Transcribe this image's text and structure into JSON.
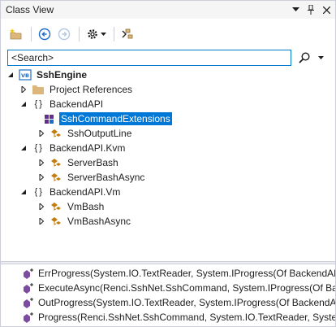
{
  "window": {
    "title": "Class View",
    "buttons": {
      "dropdown": "▾",
      "pin": "📌",
      "close": "✕"
    }
  },
  "toolbar": {
    "items": [
      "new-folder",
      "back",
      "forward",
      "settings",
      "sync"
    ]
  },
  "search": {
    "value": "<Search>"
  },
  "tree": {
    "root": {
      "label": "SshEngine",
      "badge": "VB"
    },
    "items": [
      {
        "label": "Project References"
      },
      {
        "label": "BackendAPI",
        "ns": "{ }"
      },
      {
        "label": "SshCommandExtensions",
        "selected": true
      },
      {
        "label": "SshOutputLine"
      },
      {
        "label": "BackendAPI.Kvm",
        "ns": "{ }"
      },
      {
        "label": "ServerBash"
      },
      {
        "label": "ServerBashAsync"
      },
      {
        "label": "BackendAPI.Vm",
        "ns": "{ }"
      },
      {
        "label": "VmBash"
      },
      {
        "label": "VmBashAsync"
      }
    ]
  },
  "members": [
    {
      "label": "ErrProgress(System.IO.TextReader, System.IProgress(Of BackendAPI.S"
    },
    {
      "label": "ExecuteAsync(Renci.SshNet.SshCommand, System.IProgress(Of Back"
    },
    {
      "label": "OutProgress(System.IO.TextReader, System.IProgress(Of BackendAPI"
    },
    {
      "label": "Progress(Renci.SshNet.SshCommand, System.IO.TextReader, System."
    }
  ],
  "colors": {
    "selection": "#0078d7",
    "accent": "#007acc",
    "class_icon": "#c27d0e",
    "folder": "#dcb67a",
    "method": "#652d90"
  }
}
